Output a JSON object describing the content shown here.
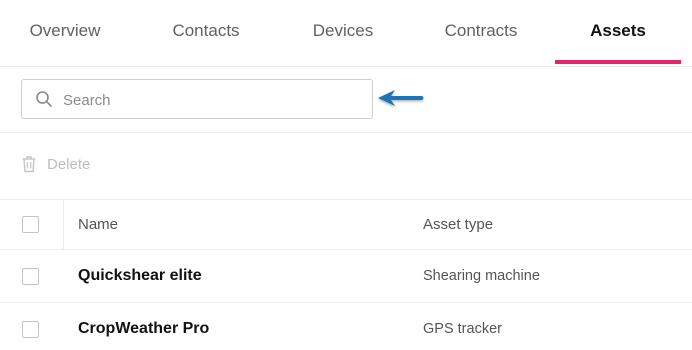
{
  "tabs": [
    {
      "label": "Overview",
      "active": false
    },
    {
      "label": "Contacts",
      "active": false
    },
    {
      "label": "Devices",
      "active": false
    },
    {
      "label": "Contracts",
      "active": false
    },
    {
      "label": "Assets",
      "active": true
    }
  ],
  "colors": {
    "accent": "#e5246f",
    "arrow": "#1a73b8"
  },
  "search": {
    "placeholder": "Search",
    "value": "",
    "icon": "search-icon"
  },
  "toolbar": {
    "delete_label": "Delete",
    "delete_icon": "trash-icon",
    "delete_enabled": false
  },
  "table": {
    "columns": [
      "Name",
      "Asset type"
    ],
    "rows": [
      {
        "name": "Quickshear elite",
        "asset_type": "Shearing machine"
      },
      {
        "name": "CropWeather Pro",
        "asset_type": "GPS tracker"
      }
    ]
  }
}
